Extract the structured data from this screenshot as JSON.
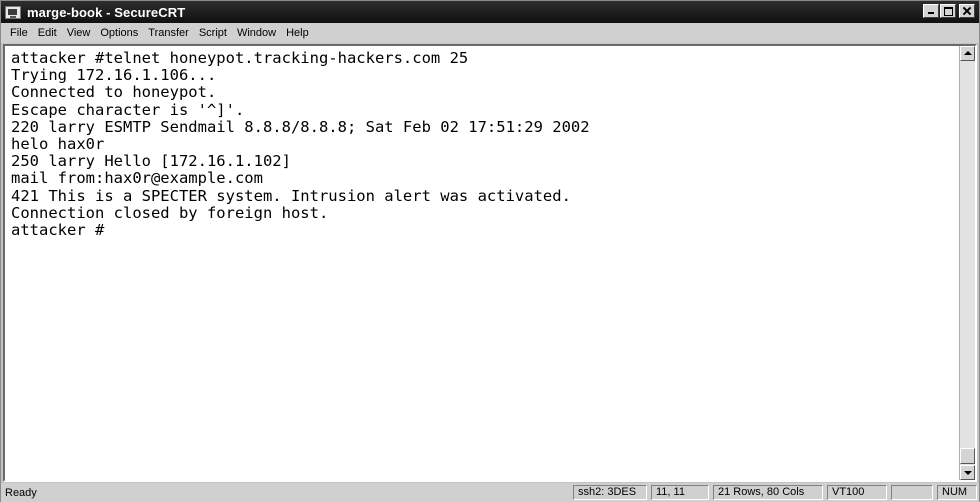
{
  "window": {
    "title": "marge-book - SecureCRT"
  },
  "menu": [
    {
      "label": "File"
    },
    {
      "label": "Edit"
    },
    {
      "label": "View"
    },
    {
      "label": "Options"
    },
    {
      "label": "Transfer"
    },
    {
      "label": "Script"
    },
    {
      "label": "Window"
    },
    {
      "label": "Help"
    }
  ],
  "terminal": {
    "lines": [
      "attacker #telnet honeypot.tracking-hackers.com 25",
      "Trying 172.16.1.106...",
      "Connected to honeypot.",
      "Escape character is '^]'.",
      "220 larry ESMTP Sendmail 8.8.8/8.8.8; Sat Feb 02 17:51:29 2002",
      "helo hax0r",
      "250 larry Hello [172.16.1.102]",
      "mail from:hax0r@example.com",
      "421 This is a SPECTER system. Intrusion alert was activated.",
      "Connection closed by foreign host.",
      "attacker #"
    ]
  },
  "status": {
    "ready": "Ready",
    "encryption": "ssh2: 3DES",
    "cursor": "11, 11",
    "size": "21 Rows, 80 Cols",
    "emulation": "VT100",
    "blank": "",
    "num": "NUM"
  }
}
